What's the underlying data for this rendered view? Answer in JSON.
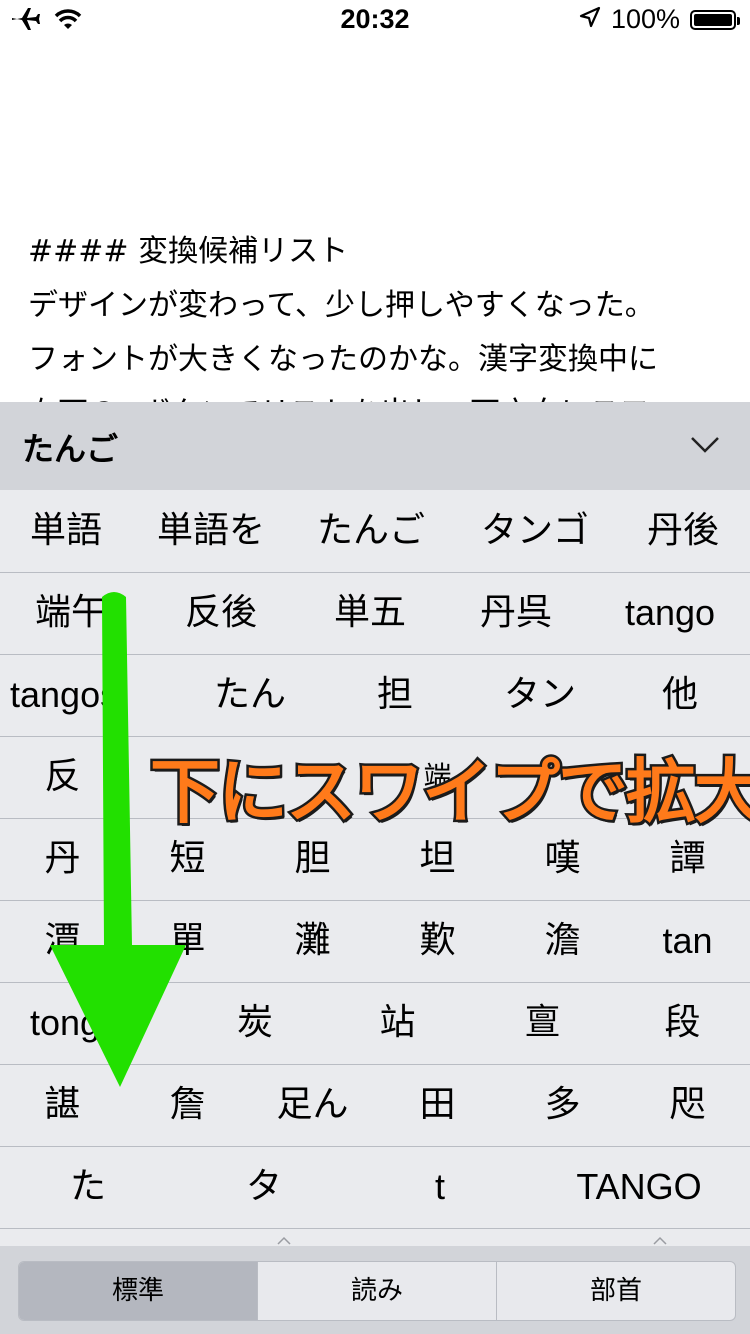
{
  "status": {
    "time": "20:32",
    "battery": "100%",
    "icons": [
      "airplane-icon",
      "wifi-icon",
      "location-arrow-icon",
      "battery-icon"
    ]
  },
  "editor": {
    "lines": [
      "#### 変換候補リスト",
      "デザインが変わって、少し押しやすくなった。",
      "フォントが大きくなったのかな。漢字変換中に",
      "右下の∨ボタンでリストを出し、下方向にスワ"
    ]
  },
  "keyboard": {
    "reading": "たんご",
    "collapse_icon": "chevron-down-icon",
    "rows": [
      [
        "単語",
        "単語を",
        "たんご",
        "タンゴ",
        "丹後"
      ],
      [
        "端午",
        "反後",
        "単五",
        "丹呉",
        "tango"
      ],
      [
        "tangos",
        "たん",
        "担",
        "タン",
        "他"
      ],
      [
        "反",
        "",
        "",
        "端",
        "",
        ""
      ],
      [
        "丹",
        "短",
        "胆",
        "坦",
        "嘆",
        "譚"
      ],
      [
        "潭",
        "單",
        "灘",
        "歎",
        "澹",
        "tan"
      ],
      [
        "tongue",
        "炭",
        "站",
        "亶",
        "段"
      ],
      [
        "諶",
        "詹",
        "足ん",
        "田",
        "多",
        "咫"
      ],
      [
        "た",
        "タ",
        "t",
        "TANGO"
      ]
    ],
    "segments": [
      "標準",
      "読み",
      "部首"
    ],
    "active_segment": "標準"
  },
  "annotation": {
    "text": "下にスワイプで拡大",
    "text_color": "#ff7a1a",
    "arrow_color": "#22e000"
  }
}
